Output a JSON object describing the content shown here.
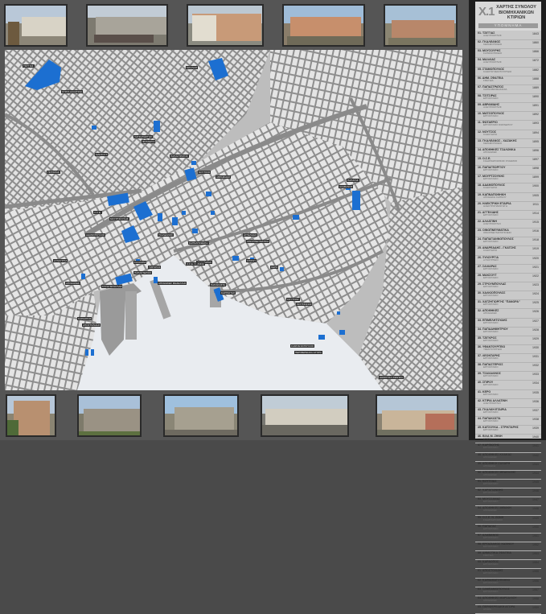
{
  "sidebar": {
    "number": "X.1",
    "title_line1": "ΧΑΡΤΗΣ ΣΥΝΟΛΟΥ",
    "title_line2": "ΒΙΟΜΗΧΑΝΙΚΩΝ",
    "title_line3": "ΚΤΙΡΙΩΝ",
    "legend": "ΥΠΟΜΝΗΜΑ",
    "items": [
      {
        "name": "01. ΤΣΙΓΓΙΑΣ",
        "sub": "ΑΛΕΥΡΟΜΥΛΟΣ",
        "year": "1843"
      },
      {
        "name": "02. ΓΚΑΛΕΑΝΟΣ",
        "sub": "ΚΕΡΑΜΟΠΟΙΕΙΟ",
        "year": "1860"
      },
      {
        "name": "03. ΜΟΥΣΟΥΡΗΣ",
        "sub": "ΣΑΠΩΝΟΠΟΙΕΙΟ",
        "year": "1866"
      },
      {
        "name": "04. ΜΑΛΛΙΑΣ",
        "sub": "ΑΛΕΥΡΟΜΥΛΟΣ",
        "year": "1872"
      },
      {
        "name": "05. ΣΤΑΜΟΠΟΥΛΟΣ",
        "sub": "ΚΛΩΣΤΟΥΦΑΝΤΟΥΡΓΕΙΟ",
        "year": "1882"
      },
      {
        "name": "06. ΔΗΜ. ΣΦΑΓΕΙΑ",
        "sub": "ΣΦΑΓΕΙΑ",
        "year": "1888"
      },
      {
        "name": "07. ΠΑΠΑΣΤΡΑΤΟΣ",
        "sub": "ΚΑΠΝΟΒΙΟΜΗΧΑΝΙΑ",
        "year": "1889"
      },
      {
        "name": "08. ΤΣΙΤΣΙΡΑΣ",
        "sub": "ΕΡΓΟΣΤΑΣΙΟ",
        "year": "1890"
      },
      {
        "name": "09. ΑΒΡΑΜΙΔΗΣ",
        "sub": "ΑΛΕΥΡΟΜΥΛΟΣ",
        "year": "1891"
      },
      {
        "name": "10. ΜΑΤΣΟΠΟΥΛΟΣ",
        "sub": "ΕΡΓΟΣΤΑΣΙΟ",
        "year": "1892"
      },
      {
        "name": "11. ΦΩΤΑΕΡΙΟ",
        "sub": "ΕΡΓΟΣΤΑΣΙΟ ΦΩΤΑΕΡΙΟΥ",
        "year": "1893"
      },
      {
        "name": "12. ΝΟΥΤΣΟΣ",
        "sub": "ΚΛΩΣΤΗΡΙΟ",
        "year": "1894"
      },
      {
        "name": "13. ΓΚΑΛΕΑΝΟΣ - ΧΑΖΑΚΗΣ",
        "sub": "ΚΕΡΑΜΟΠΟΙΕΙΟ",
        "year": "1895"
      },
      {
        "name": "14. ΑΠΟΘΗΚΕΣ ΤΣΑΛΟΝΚΑ",
        "sub": "ΑΠΟΘΗΚΕΣ",
        "year": "1896"
      },
      {
        "name": "15. Ο.Σ.Ε.",
        "sub": "ΣΙΔΗΡΟΔΡΟΜΙΚΟΣ ΣΤΑΘΜΟΣ",
        "year": "1897"
      },
      {
        "name": "16. ΠΑΠΑΓΕΩΡΓΙΟΥ",
        "sub": "ΕΡΓΟΣΤΑΣΙΟ",
        "year": "1898"
      },
      {
        "name": "17. ΜΟΥΡΤΖΟΥΚΗΣ",
        "sub": "ΕΡΓΟΣΤΑΣΙΟ",
        "year": "1899"
      },
      {
        "name": "18. ΑΔΑΜΟΠΟΥΛΟΣ",
        "sub": "ΚΛΩΣΤΗΡΙΟ",
        "year": "1900"
      },
      {
        "name": "19. ΚΑΠΝΑΠΟΘΗΚΗ",
        "sub": "ΑΠΟΘΗΚΗ ΚΑΠΝΟΥ",
        "year": "1905"
      },
      {
        "name": "20. ΗΛΕΚΤΡΙΚΗ ΕΤΑΙΡΙΑ",
        "sub": "ΗΛΕΚΤΡΟΠΑΡΑΓΩΓΗ",
        "year": "1911"
      },
      {
        "name": "21. ΑΓΓΕΛΙΔΗΣ",
        "sub": "ΕΡΓΟΣΤΑΣΙΟ",
        "year": "1914"
      },
      {
        "name": "22. ΑΛΛΑΤΙΝΗ",
        "sub": "ΑΛΕΥΡΟΜΥΛΟΙ",
        "year": "1915"
      },
      {
        "name": "23. ΟΙΝΟΠΝΕΥΜΑΤΙΚΑ",
        "sub": "ΟΙΝΟΠΝΕΥΜΑΤΟΠΟΙΕΙΟ",
        "year": "1916"
      },
      {
        "name": "24. ΠΑΠΑΓΙΑΝΝΟΠΟΥΛΟΣ",
        "sub": "ΕΡΓΟΣΤΑΣΙΟ",
        "year": "1918"
      },
      {
        "name": "25. ΑΝΔΡΕΑΔΗΣ - ΓΚΑΤΣΗΣ",
        "sub": "ΚΛΩΣΤΗΡΙΟ",
        "year": "1919"
      },
      {
        "name": "26. ΞΥΛΟΥΡΓΙΑ",
        "sub": "ΞΥΛΟΥΡΓΕΙΟ",
        "year": "1920"
      },
      {
        "name": "27. ΣΑΛΙΑΡΑΣ",
        "sub": "ΕΡΓΟΣΤΑΣΙΟ",
        "year": "1921"
      },
      {
        "name": "28. ΜΑΚΣΟΥΤ",
        "sub": "ΕΡΓΟΣΤΑΣΙΟ",
        "year": "1922"
      },
      {
        "name": "29. ΣΤΡΟΥΜΠΟΥΛΑΣ",
        "sub": "ΕΡΓΟΣΤΑΣΙΟ",
        "year": "1923"
      },
      {
        "name": "30. ΧΑΛΚΙΟΠΟΥΛΟΣ",
        "sub": "ΕΡΓΟΣΤΑΣΙΟ",
        "year": "1924"
      },
      {
        "name": "31. ΧΑΤΖΗΓΙΩΡΓΗΣ \"ΠΑΝΟΡΑ\"",
        "sub": "ΕΡΓΟΣΤΑΣΙΟ",
        "year": "1925"
      },
      {
        "name": "32. ΑΠΟΘΗΚΕΣ",
        "sub": "ΑΠΟΘΗΚΕΣ",
        "year": "1926"
      },
      {
        "name": "33. ΕΠΙΜΕΛΗΤΟΥΔΗΣ",
        "sub": "ΕΡΓΟΣΤΑΣΙΟ",
        "year": "1927"
      },
      {
        "name": "34. ΠΑΠΑΔΗΜΗΤΡΙΟΥ",
        "sub": "ΕΡΓΟΣΤΑΣΙΟ",
        "year": "1928"
      },
      {
        "name": "35. ΤΖΙΓΚΡΟΣ",
        "sub": "ΕΡΓΟΣΤΑΣΙΟ",
        "year": "1929"
      },
      {
        "name": "36. ΥΦΑΝΤΟΥΡΓΕΙΟ",
        "sub": "ΥΦΑΝΤΟΥΡΓΕΙΟ",
        "year": "1930"
      },
      {
        "name": "37. ΛΕΟΝΤΑΡΗΣ",
        "sub": "ΕΡΓΟΣΤΑΣΙΟ",
        "year": "1931"
      },
      {
        "name": "38. ΠΑΠΑΣΤΕΡΙΟΣ",
        "sub": "ΕΡΓΟΣΤΑΣΙΟ",
        "year": "1932"
      },
      {
        "name": "39. ΤΣΑΧΑΛΙΝΟΣ",
        "sub": "ΕΡΓΟΣΤΑΣΙΟ",
        "year": "1933"
      },
      {
        "name": "40. ΣΠΙΡΟΥ",
        "sub": "ΕΡΓΟΣΤΑΣΙΟ",
        "year": "1934"
      },
      {
        "name": "41. ΚΕΡΟ",
        "sub": "ΕΡΓΟΣΤΑΣΙΟ",
        "year": "1935"
      },
      {
        "name": "42. ΚΤΙΡΙΑ ΑΛΛΑΤΙΝΗ",
        "sub": "ΑΛΕΥΡΟΜΥΛΟΙ",
        "year": "1936"
      },
      {
        "name": "43. ΓΚΑΛΚΗ ΕΤΑΙΡΙΑ",
        "sub": "ΕΡΓΟΣΤΑΣΙΟ",
        "year": "1937"
      },
      {
        "name": "44. ΠΑΠΑΚΩΣΤΑ",
        "sub": "ΕΡΓΟΣΤΑΣΙΟ",
        "year": "1938"
      },
      {
        "name": "45. ΚΑΤΣΟΥΚΑ - ΣΤΡΙΚΤΑΡΗΣ",
        "sub": "ΕΡΓΟΣΤΑΣΙΟ",
        "year": "1939"
      },
      {
        "name": "46. ΒΙΛΑ Μ. ΖΗΝΗ",
        "sub": "ΚΤΙΡΙΟ",
        "year": "1940"
      },
      {
        "name": "47. ΚΑΡΠΙΩΤΗΣ",
        "sub": "ΕΡΓΟΣΤΑΣΙΟ",
        "year": "1941"
      },
      {
        "name": "48. ΑΠΟΘΗΚΕΣ ΚΛΑΚΑΣ",
        "sub": "ΑΠΟΘΗΚΕΣ",
        "year": "1942"
      },
      {
        "name": "49. ΑΠΟΘΗΚΗ ΖΑΧΑΡΗ",
        "sub": "ΑΠΟΘΗΚΗ",
        "year": "1943"
      },
      {
        "name": "50. ΑΠΟΘΗΚΕΣ ΜΕΔΕΛΛΗΣ",
        "sub": "ΑΠΟΘΗΚΕΣ",
        "year": "1944"
      },
      {
        "name": "51. ΚΟΥΤΣΙΑΣ",
        "sub": "ΕΡΓΟΣΤΑΣΙΟ",
        "year": "1945"
      },
      {
        "name": "52. ΚΑΡΑΓΙΑΝΝΗΣ",
        "sub": "ΕΡΓΟΣΤΑΣΙΟ",
        "year": "1946"
      },
      {
        "name": "53. ΜΟΥΣΣΑΝΑΣ",
        "sub": "ΕΡΓΟΣΤΑΣΙΟ",
        "year": "1947"
      },
      {
        "name": "54. ΑΠΟΘΗΚΕΣ ΙΜΒΑΚΗ",
        "sub": "ΑΠΟΘΗΚΕΣ",
        "year": "1948"
      },
      {
        "name": "55. Ο.Σ.Ε. Ν. ΖΩΝΗ",
        "sub": "ΣΙΔΗΡΟΔΡΟΜΟΣ",
        "year": "1949"
      },
      {
        "name": "56. ΠΑΠΑΓΑΣ",
        "sub": "ΕΡΓΟΣΤΑΣΙΟ",
        "year": "1950"
      },
      {
        "name": "57. ΑΛΑΒΑΝΟΣ",
        "sub": "ΕΡΓΟΣΤΑΣΙΟ",
        "year": "1951"
      },
      {
        "name": "58. ΕΡΓΑΣΙΑΚΟΣ ΧΑΣΙΝΟΥ",
        "sub": "ΕΡΓΟΣΤΑΣΙΟ",
        "year": "1952"
      },
      {
        "name": "59. ΔΗΜΟΤΙΚΑ ΣΦΑΓΕΙΑ",
        "sub": "ΣΦΑΓΕΙΑ",
        "year": "1953"
      },
      {
        "name": "60. ΚΑΡΑΟΠΟΣ",
        "sub": "ΕΡΓΟΣΤΑΣΙΟ",
        "year": "1954"
      },
      {
        "name": "61. ΑΠΟΣΤΟΛΙΔΗΣ",
        "sub": "ΕΡΓΟΣΤΑΣΙΟ",
        "year": "1955"
      },
      {
        "name": "62. ΚΑΘΙΑΜΑΤΟΠΟΙΕΙΟ",
        "sub": "ΕΡΓΟΣΤΑΣΙΟ",
        "year": "1956"
      },
      {
        "name": "63. ΣΑΜΠΑΝΙΟΠΟΥΛΟΣ",
        "sub": "ΕΡΓΟΣΤΑΣΙΟ",
        "year": "1957"
      },
      {
        "name": "64. ΑΠΟΘΗΚΕΣ ΜΑΡΣΑΛΙΟΥ",
        "sub": "ΑΠΟΘΗΚΕΣ",
        "year": "1958"
      },
      {
        "name": "65. ΠΕΡΙΦΕΡΕΙΑΚΗ ΑΓΟΡΑ",
        "sub": "ΑΓΟΡΑ",
        "year": "1959"
      }
    ]
  },
  "colors": {
    "background": "#555555",
    "map_land": "#bdbdbd",
    "blocks": "#e6e6e6",
    "roads": "#8e8e8e",
    "sea": "#e9ecf0",
    "industrial_buildings": "#1c6fd1",
    "sidebar": "#c9c9c9"
  },
  "map_labels": [
    "ΤΣΙΓΓΙΑΣ",
    "ΜΑΛΛΙΑΣ",
    "ΚΤΙΡΙΑ ΑΛΛΑΤΙΝΗ",
    "ΧΑΤΖΗΓΙΩΡΓΗΣ",
    "ΦΩΤΑΕΡΙΟ",
    "ΜΑΚΣΟΥΤ",
    "ΤΣΙΤΣΙΡΑΣ",
    "ΠΑΠΑΣΤΡΑΤΟΣ",
    "ΝΟΥΤΣΟΣ",
    "ΑΒΡΑΜΙΔΗΣ",
    "Ο.Σ.Ε.",
    "ΜΟΥΡΤΖΟΥΚΗΣ",
    "ΑΔΑΜΟΠΟΥΛΟΣ",
    "ΓΚΑΛΕΑΝΟΣ",
    "ΚΑΠΝΑΠΟΘΗΚΗ",
    "ΑΓΓΕΛΙΔΗΣ",
    "ΟΙΝΟΠΝΕΥΜΑΤΙΚΑ",
    "ΣΑΛΙΑΡΑΣ",
    "ΣΤΡΟΥΜΠΟΥΛΑΣ",
    "ΑΠΟΘΗΚΕΣ",
    "ΤΖΙΓΚΡΟΣ",
    "ΛΕΟΝΤΑΡΗΣ",
    "ΣΠΙΡΟΥ",
    "ΚΕΡΟ",
    "ΠΑΠΑΚΩΣΤΑ",
    "ΚΑΡΠΙΩΤΗΣ",
    "ΚΟΥΤΣΙΑΣ",
    "ΜΟΥΣΣΑΝΑΣ",
    "ΠΑΠΑΓΑΣ",
    "ΑΛΑΒΑΝΟΣ",
    "ΚΑΡΑΟΠΟΣ",
    "ΑΠΟΣΤΟΛΙΔΗΣ",
    "ΣΑΜΠΑΝΙΟΠΟΥΛΟΣ",
    "ΠΕΡΙΦΕΡΕΙΑΚΗ ΑΓΟΡΑ",
    "ΔΗΜΟΤΙΚΑ ΣΦΑΓΕΙΑ",
    "ΑΠΟΘΗΚΕΣ ΜΕΔΕΛΛΗΣ",
    "Ο.Σ.Ε. Ν. ΖΩΝΗ",
    "ΠΑΠΑΣΤΕΡΙΟΣ",
    "ΞΥΛΟΥΡΓΙΑ"
  ]
}
